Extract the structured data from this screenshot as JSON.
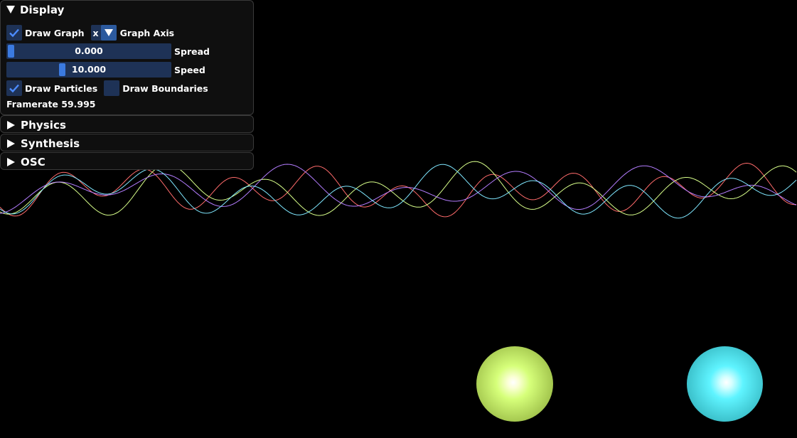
{
  "display": {
    "title": "Display",
    "draw_graph_label": "Draw Graph",
    "draw_graph_checked": true,
    "graph_axis_value": "x",
    "graph_axis_label": "Graph Axis",
    "spread": {
      "value": "0.000",
      "label": "Spread",
      "fraction": 0.0
    },
    "speed": {
      "value": "10.000",
      "label": "Speed",
      "fraction": 0.33
    },
    "draw_particles_label": "Draw Particles",
    "draw_particles_checked": true,
    "draw_boundaries_label": "Draw Boundaries",
    "draw_boundaries_checked": false,
    "framerate_text": "Framerate 59.995"
  },
  "physics": {
    "title": "Physics"
  },
  "synthesis": {
    "title": "Synthesis"
  },
  "osc": {
    "title": "OSC"
  },
  "colors": {
    "checkbox_bg": "#1e3256",
    "accent": "#3b7ae0",
    "wave_red": "#ff6b6b",
    "wave_green": "#d8ff8a",
    "wave_violet": "#b47dff",
    "wave_cyan": "#7fe7ff",
    "particle_lime": "#d6ff7a",
    "particle_cyan": "#5ff4ff"
  },
  "icons": [
    "checkmark-icon",
    "triangle-down-icon",
    "triangle-right-icon"
  ]
}
